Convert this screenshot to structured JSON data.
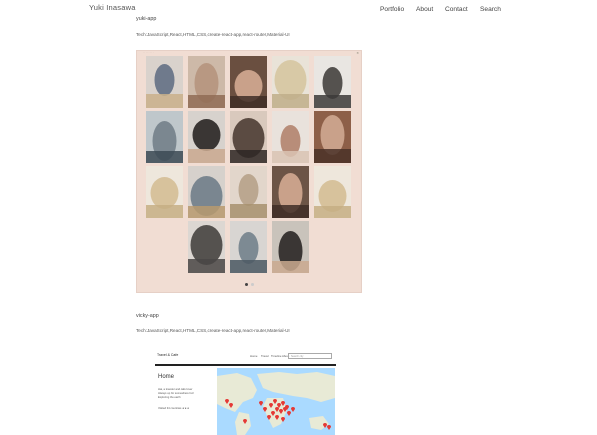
{
  "header": {
    "site_title": "Yuki Inasawa",
    "nav": [
      "Portfolio",
      "About",
      "Contact",
      "Search"
    ]
  },
  "projects": [
    {
      "title": "yuki-app",
      "tech": "Tech:JavaScript,React,HTML,CSS,create-react-app,react-router,Material-UI"
    },
    {
      "title": "vicky-app",
      "tech": "Tech:JavaScript,React,HTML,CSS,create-react-app,react-router,Material-UI"
    }
  ],
  "shot2": {
    "brand": "Travel & Cafe",
    "nav": [
      "Home",
      "Travel",
      "Timeline",
      "About"
    ],
    "search_placeholder": "Search city",
    "home_heading": "Home",
    "lines": [
      "Hai, a traveler and cafe lover",
      "Always up for somewhere fun!",
      "Exploring the earth"
    ],
    "visited": "Visited 34 countries ★★★"
  },
  "colors": {
    "page_background": "#ffffff",
    "screenshot_bg": "#f1ddd3",
    "map_water": "#aadaff",
    "map_land": "#f2efe9",
    "pin": "#e53935"
  }
}
